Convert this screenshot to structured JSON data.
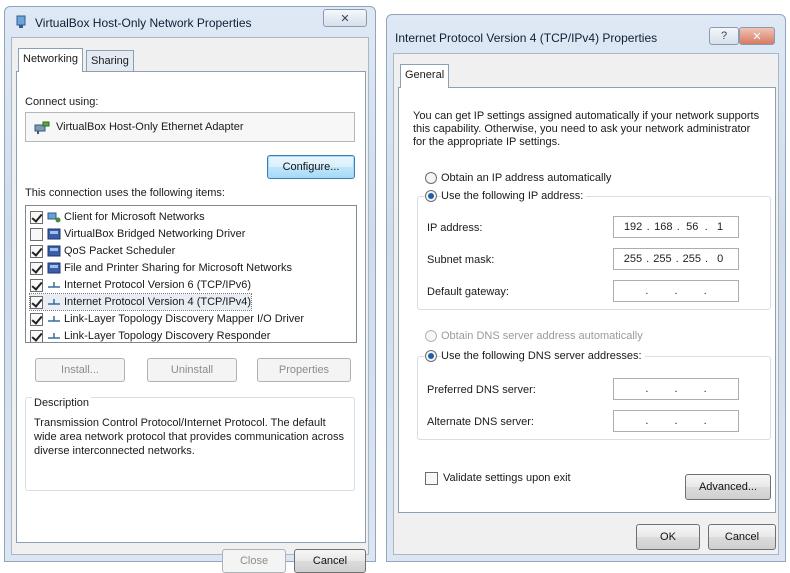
{
  "left_dialog": {
    "title": "VirtualBox Host-Only Network Properties",
    "close_glyph": "✕",
    "tabs": [
      "Networking",
      "Sharing"
    ],
    "connect_using_label": "Connect using:",
    "adapter_name": "VirtualBox Host-Only Ethernet Adapter",
    "configure_label": "Configure...",
    "items_label": "This connection uses the following items:",
    "items": [
      {
        "label": "Client for Microsoft Networks",
        "checked": true,
        "icon": "network-client-icon"
      },
      {
        "label": "VirtualBox Bridged Networking Driver",
        "checked": false,
        "icon": "driver-icon"
      },
      {
        "label": "QoS Packet Scheduler",
        "checked": true,
        "icon": "scheduler-icon"
      },
      {
        "label": "File and Printer Sharing for Microsoft Networks",
        "checked": true,
        "icon": "sharing-icon"
      },
      {
        "label": "Internet Protocol Version 6 (TCP/IPv6)",
        "checked": true,
        "icon": "protocol-icon"
      },
      {
        "label": "Internet Protocol Version 4 (TCP/IPv4)",
        "checked": true,
        "icon": "protocol-icon"
      },
      {
        "label": "Link-Layer Topology Discovery Mapper I/O Driver",
        "checked": true,
        "icon": "protocol-icon"
      },
      {
        "label": "Link-Layer Topology Discovery Responder",
        "checked": true,
        "icon": "protocol-icon"
      }
    ],
    "install_label": "Install...",
    "uninstall_label": "Uninstall",
    "properties_label": "Properties",
    "description_label": "Description",
    "description_text": "Transmission Control Protocol/Internet Protocol. The default wide area network protocol that provides communication across diverse interconnected networks.",
    "close_label": "Close",
    "cancel_label": "Cancel"
  },
  "right_dialog": {
    "title": "Internet Protocol Version 4 (TCP/IPv4) Properties",
    "help_glyph": "?",
    "close_glyph": "✕",
    "tab": "General",
    "intro_text": "You can get IP settings assigned automatically if your network supports this capability. Otherwise, you need to ask your network administrator for the appropriate IP settings.",
    "obtain_ip_label": "Obtain an IP address automatically",
    "use_ip_label": "Use the following IP address:",
    "ip_address_label": "IP address:",
    "ip_address": [
      "192",
      "168",
      "56",
      "1"
    ],
    "subnet_mask_label": "Subnet mask:",
    "subnet_mask": [
      "255",
      "255",
      "255",
      "0"
    ],
    "default_gateway_label": "Default gateway:",
    "default_gateway": [
      "",
      "",
      "",
      ""
    ],
    "obtain_dns_label": "Obtain DNS server address automatically",
    "use_dns_label": "Use the following DNS server addresses:",
    "preferred_dns_label": "Preferred DNS server:",
    "preferred_dns": [
      "",
      "",
      "",
      ""
    ],
    "alternate_dns_label": "Alternate DNS server:",
    "alternate_dns": [
      "",
      "",
      "",
      ""
    ],
    "validate_label": "Validate settings upon exit",
    "advanced_label": "Advanced...",
    "ok_label": "OK",
    "cancel_label": "Cancel"
  },
  "colors": {
    "selection_accent": "#1f5ea8",
    "focus_border": "#3c7fb1"
  }
}
